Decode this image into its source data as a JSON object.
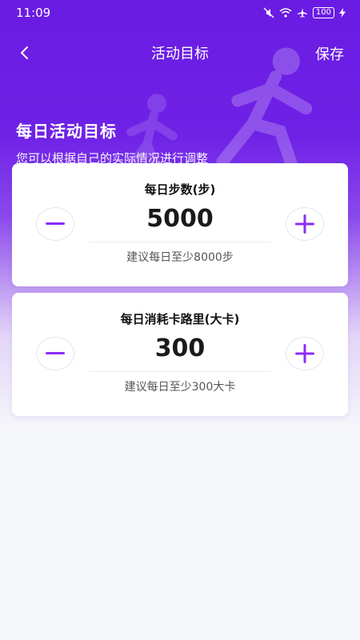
{
  "status_bar": {
    "time": "11:09",
    "battery": "100"
  },
  "nav": {
    "title": "活动目标",
    "save_label": "保存"
  },
  "intro": {
    "title": "每日活动目标",
    "subtitle": "您可以根据自己的实际情况进行调整"
  },
  "cards": [
    {
      "title": "每日步数(步)",
      "value": "5000",
      "hint": "建议每日至少8000步"
    },
    {
      "title": "每日消耗卡路里(大卡)",
      "value": "300",
      "hint": "建议每日至少300大卡"
    }
  ],
  "colors": {
    "accent": "#8b2cf5",
    "header": "#6a1be3"
  },
  "icons": [
    "back-arrow-icon",
    "minus-icon",
    "plus-icon",
    "wifi-icon",
    "airplane-icon",
    "mute-icon",
    "charging-icon"
  ]
}
